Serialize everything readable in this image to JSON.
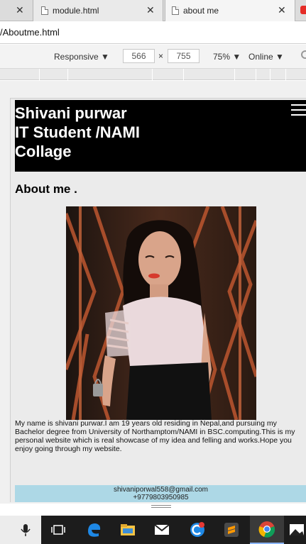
{
  "browser": {
    "tabs": [
      {
        "label": "module.html"
      },
      {
        "label": "about me"
      }
    ],
    "url": "/Aboutme.html"
  },
  "devtools": {
    "device": "Responsive",
    "width": "566",
    "times": "×",
    "height": "755",
    "zoom": "75%",
    "network": "Online"
  },
  "page": {
    "header": {
      "line1": "Shivani purwar",
      "line2": "IT Student /NAMI",
      "line3": "Collage"
    },
    "about_heading": "About me .",
    "bio": "My name is shivani purwar.I am 19 years old residing in Nepal,and pursuing my Bachelor degree from University of Northamptom/NAMI in BSC.computing.This is my personal website which is real showcase of my idea and felling and works.Hope you enjoy going through my website.",
    "footer": {
      "email": "shivaniporwal558@gmail.com",
      "phone": "+9779803950985"
    }
  },
  "taskbar": {
    "apps": [
      "microphone-icon",
      "task-view-icon",
      "edge-icon",
      "file-explorer-icon",
      "mail-icon",
      "ccleaner-icon",
      "sublime-icon",
      "chrome-icon",
      "photos-icon"
    ]
  }
}
